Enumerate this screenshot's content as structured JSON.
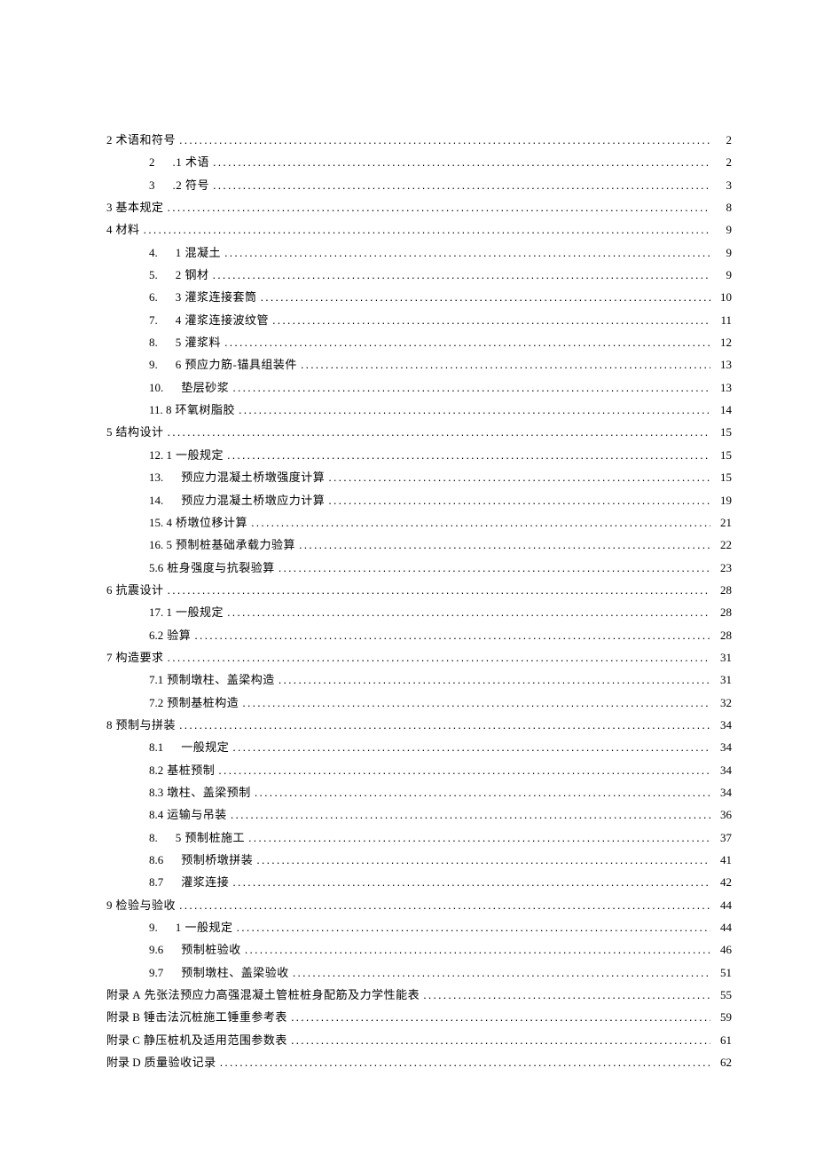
{
  "toc": [
    {
      "level": 1,
      "num": "2",
      "title": "术语和符号",
      "page": "2",
      "spaced": false
    },
    {
      "level": 2,
      "num": "2",
      "title": ".1 术语",
      "page": "2",
      "spaced": true
    },
    {
      "level": 2,
      "num": "3",
      "title": ".2 符号",
      "page": "3",
      "spaced": true
    },
    {
      "level": 1,
      "num": "3",
      "title": "基本规定",
      "page": "8",
      "spaced": false
    },
    {
      "level": 1,
      "num": "4",
      "title": "材料",
      "page": "9",
      "spaced": false
    },
    {
      "level": 2,
      "num": "4.",
      "title": "1 混凝土",
      "page": "9",
      "spaced": true
    },
    {
      "level": 2,
      "num": "5.",
      "title": "2 钢材",
      "page": "9",
      "spaced": true
    },
    {
      "level": 2,
      "num": "6.",
      "title": "3 灌浆连接套筒",
      "page": "10",
      "spaced": true
    },
    {
      "level": 2,
      "num": "7.",
      "title": "4 灌浆连接波纹管",
      "page": "11",
      "spaced": true
    },
    {
      "level": 2,
      "num": "8.",
      "title": "5 灌浆料",
      "page": "12",
      "spaced": true
    },
    {
      "level": 2,
      "num": "9.",
      "title": "6 预应力筋-锚具组装件",
      "page": "13",
      "spaced": true
    },
    {
      "level": 2,
      "num": "10.",
      "title": "垫层砂浆",
      "page": "13",
      "spaced": true
    },
    {
      "level": 2,
      "num": "11. 8",
      "title": "环氧树脂胶",
      "page": "14",
      "spaced": false
    },
    {
      "level": 1,
      "num": "5",
      "title": "结构设计",
      "page": "15",
      "spaced": false
    },
    {
      "level": 2,
      "num": "12. 1",
      "title": "一般规定",
      "page": "15",
      "spaced": false
    },
    {
      "level": 2,
      "num": "13.",
      "title": "预应力混凝土桥墩强度计算",
      "page": "15",
      "spaced": true
    },
    {
      "level": 2,
      "num": "14.",
      "title": "预应力混凝土桥墩应力计算",
      "page": "19",
      "spaced": true
    },
    {
      "level": 2,
      "num": "15. 4",
      "title": "桥墩位移计算",
      "page": "21",
      "spaced": false
    },
    {
      "level": 2,
      "num": "16. 5",
      "title": "预制桩基础承载力验算",
      "page": "22",
      "spaced": false
    },
    {
      "level": 2,
      "num": "5.6",
      "title": "桩身强度与抗裂验算",
      "page": "23",
      "spaced": false
    },
    {
      "level": 1,
      "num": "6",
      "title": "抗震设计",
      "page": "28",
      "spaced": false
    },
    {
      "level": 2,
      "num": "17. 1",
      "title": "一般规定",
      "page": "28",
      "spaced": false
    },
    {
      "level": 2,
      "num": "6.2",
      "title": "验算",
      "page": "28",
      "spaced": false
    },
    {
      "level": 1,
      "num": "7",
      "title": "构造要求",
      "page": "31",
      "spaced": false
    },
    {
      "level": 2,
      "num": "7.1",
      "title": "预制墩柱、盖梁构造",
      "page": "31",
      "spaced": false
    },
    {
      "level": 2,
      "num": "7.2",
      "title": "预制基桩构造",
      "page": "32",
      "spaced": false
    },
    {
      "level": 1,
      "num": "8",
      "title": "预制与拼装",
      "page": "34",
      "spaced": false
    },
    {
      "level": 2,
      "num": "8.1",
      "title": "一般规定",
      "page": "34",
      "spaced": true
    },
    {
      "level": 2,
      "num": "8.2",
      "title": "基桩预制",
      "page": "34",
      "spaced": false
    },
    {
      "level": 2,
      "num": "8.3",
      "title": "墩柱、盖梁预制",
      "page": "34",
      "spaced": false
    },
    {
      "level": 2,
      "num": "8.4",
      "title": "运输与吊装",
      "page": "36",
      "spaced": false
    },
    {
      "level": 2,
      "num": "8.",
      "title": "5 预制桩施工",
      "page": "37",
      "spaced": true
    },
    {
      "level": 2,
      "num": "8.6",
      "title": "预制桥墩拼装",
      "page": "41",
      "spaced": true
    },
    {
      "level": 2,
      "num": "8.7",
      "title": "灌浆连接",
      "page": "42",
      "spaced": true
    },
    {
      "level": 1,
      "num": "9",
      "title": "检验与验收",
      "page": "44",
      "spaced": false
    },
    {
      "level": 2,
      "num": "9.",
      "title": "1 一般规定",
      "page": "44",
      "spaced": true
    },
    {
      "level": 2,
      "num": "9.6",
      "title": "预制桩验收",
      "page": "46",
      "spaced": true
    },
    {
      "level": 2,
      "num": "9.7",
      "title": "预制墩柱、盖梁验收",
      "page": "51",
      "spaced": true
    },
    {
      "level": 1,
      "num": "附录 A",
      "title": "先张法预应力高强混凝土管桩桩身配筋及力学性能表",
      "page": "55",
      "spaced": false
    },
    {
      "level": 1,
      "num": "附录 B",
      "title": "锤击法沉桩施工锤重参考表",
      "page": "59",
      "spaced": false
    },
    {
      "level": 1,
      "num": "附录 C",
      "title": "静压桩机及适用范围参数表",
      "page": "61",
      "spaced": false
    },
    {
      "level": 1,
      "num": "附录 D",
      "title": "质量验收记录",
      "page": "62",
      "spaced": false
    }
  ]
}
